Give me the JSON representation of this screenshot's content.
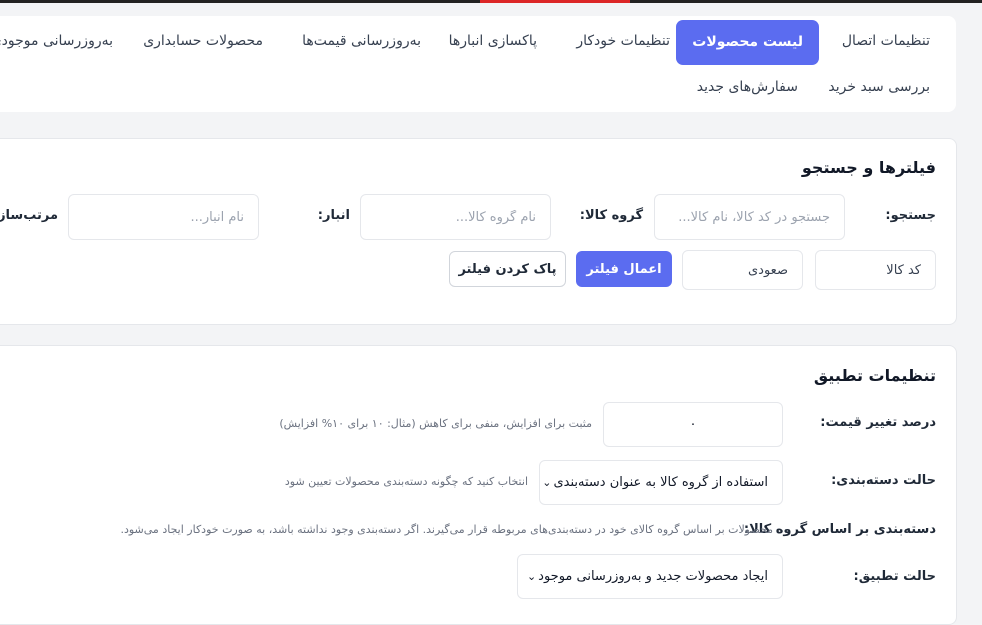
{
  "tabs": {
    "row1": [
      {
        "label": "تنظیمات اتصال"
      },
      {
        "label": "لیست محصولات",
        "active": true
      },
      {
        "label": "تنظیمات خودکار"
      },
      {
        "label": "پاکسازی انبارها"
      },
      {
        "label": "به‌روزرسانی قیمت‌ها"
      },
      {
        "label": "محصولات حسابداری"
      },
      {
        "label": "به‌روزرسانی موجودی"
      }
    ],
    "row2": [
      {
        "label": "بررسی سبد خرید"
      },
      {
        "label": "سفارش‌های جدید"
      }
    ]
  },
  "filters": {
    "title": "فیلترها و جستجو",
    "search_label": "جستجو:",
    "search_placeholder": "جستجو در کد کالا، نام کالا...",
    "group_label": "گروه کالا:",
    "group_placeholder": "نام گروه کالا...",
    "warehouse_label": "انبار:",
    "warehouse_placeholder": "نام انبار...",
    "sort_label": "مرتب‌سازی:",
    "sort_field": "کد کالا",
    "sort_order": "صعودی",
    "apply_button": "اعمال فیلتر",
    "clear_button": "پاک کردن فیلتر"
  },
  "apply_settings": {
    "title": "تنظیمات تطبیق",
    "price_label": "درصد تغییر قیمت:",
    "price_value": "۰",
    "price_hint": "مثبت برای افزایش، منفی برای کاهش (مثال: ۱۰ برای ۱۰% افزایش)",
    "category_mode_label": "حالت دسته‌بندی:",
    "category_mode_value": "استفاده از گروه کالا به عنوان دسته‌بندی",
    "category_mode_hint": "انتخاب کنید که چگونه دسته‌بندی محصولات تعیین شود",
    "category_group_label": "دسته‌بندی بر اساس گروه کالا:",
    "category_group_desc": "محصولات بر اساس گروه کالای خود در دسته‌بندی‌های مربوطه قرار می‌گیرند. اگر دسته‌بندی وجود نداشته باشد، به صورت خودکار ایجاد می‌شود.",
    "apply_mode_label": "حالت تطبیق:",
    "apply_mode_value": "ایجاد محصولات جدید و به‌روزرسانی موجود"
  },
  "colors": {
    "accent": "#5b6cf0",
    "danger_line": "#dc2626"
  }
}
